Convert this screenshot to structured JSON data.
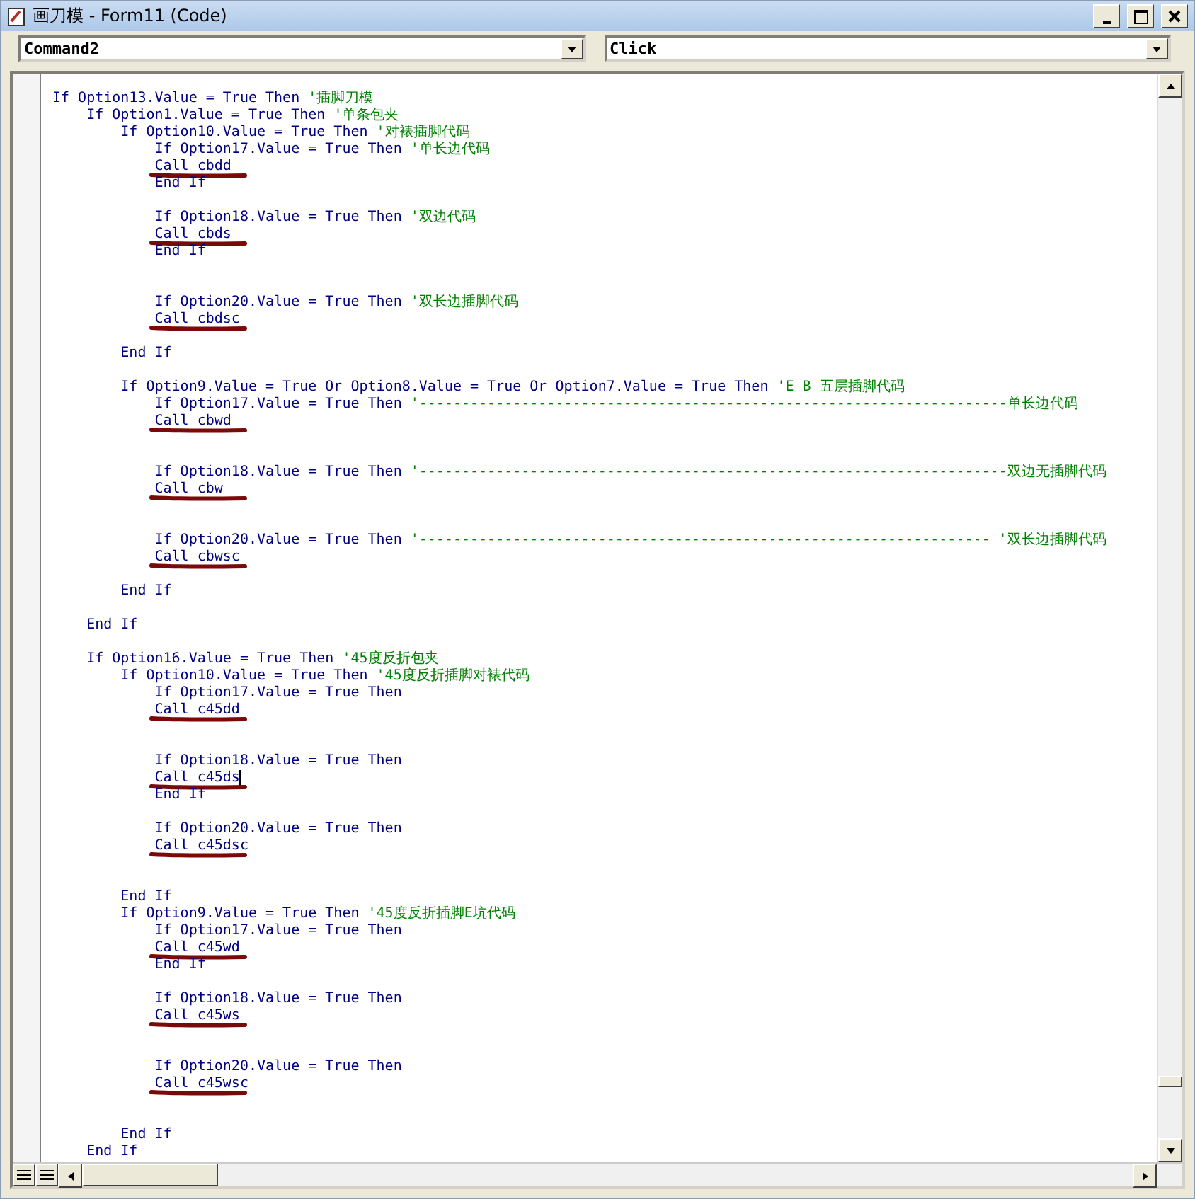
{
  "window": {
    "title": "画刀模 - Form11 (Code)"
  },
  "object_combo": {
    "value": "Command2"
  },
  "procedure_combo": {
    "value": "Click"
  },
  "code_lines": [
    {
      "kind": "code",
      "code": "If Option13.Value = True Then ",
      "comment": "'插脚刀模"
    },
    {
      "kind": "code",
      "code": "    If Option1.Value = True Then ",
      "comment": "'单条包夹"
    },
    {
      "kind": "code",
      "code": "        If Option10.Value = True Then ",
      "comment": "'对裱插脚代码"
    },
    {
      "kind": "code",
      "code": "            If Option17.Value = True Then ",
      "comment": "'单长边代码"
    },
    {
      "kind": "code",
      "code": "            Call cbdd",
      "redacted": true
    },
    {
      "kind": "code",
      "code": "            End If"
    },
    {
      "kind": "blank"
    },
    {
      "kind": "code",
      "code": "            If Option18.Value = True Then ",
      "comment": "'双边代码"
    },
    {
      "kind": "code",
      "code": "            Call cbds",
      "redacted": true
    },
    {
      "kind": "code",
      "code": "            End If"
    },
    {
      "kind": "blank"
    },
    {
      "kind": "blank"
    },
    {
      "kind": "code",
      "code": "            If Option20.Value = True Then ",
      "comment": "'双长边插脚代码"
    },
    {
      "kind": "code",
      "code": "            Call cbdsc",
      "redacted": true
    },
    {
      "kind": "blank"
    },
    {
      "kind": "code",
      "code": "        End If"
    },
    {
      "kind": "blank"
    },
    {
      "kind": "code",
      "code": "        If Option9.Value = True Or Option8.Value = True Or Option7.Value = True Then ",
      "comment": "'E B 五层插脚代码"
    },
    {
      "kind": "code",
      "code": "            If Option17.Value = True Then ",
      "comment": "'---------------------------------------------------------------------单长边代码"
    },
    {
      "kind": "code",
      "code": "            Call cbwd",
      "redacted": true
    },
    {
      "kind": "blank"
    },
    {
      "kind": "blank"
    },
    {
      "kind": "code",
      "code": "            If Option18.Value = True Then ",
      "comment": "'---------------------------------------------------------------------双边无插脚代码"
    },
    {
      "kind": "code",
      "code": "            Call cbw",
      "redacted": true
    },
    {
      "kind": "blank"
    },
    {
      "kind": "blank"
    },
    {
      "kind": "code",
      "code": "            If Option20.Value = True Then ",
      "comment": "'------------------------------------------------------------------- '双长边插脚代码"
    },
    {
      "kind": "code",
      "code": "            Call cbwsc",
      "redacted": true
    },
    {
      "kind": "blank"
    },
    {
      "kind": "code",
      "code": "        End If"
    },
    {
      "kind": "blank"
    },
    {
      "kind": "code",
      "code": "    End If"
    },
    {
      "kind": "blank"
    },
    {
      "kind": "code",
      "code": "    If Option16.Value = True Then ",
      "comment": "'45度反折包夹"
    },
    {
      "kind": "code",
      "code": "        If Option10.Value = True Then ",
      "comment": "'45度反折插脚对裱代码"
    },
    {
      "kind": "code",
      "code": "            If Option17.Value = True Then"
    },
    {
      "kind": "code",
      "code": "            Call c45dd",
      "redacted": true
    },
    {
      "kind": "blank"
    },
    {
      "kind": "blank"
    },
    {
      "kind": "code",
      "code": "            If Option18.Value = True Then"
    },
    {
      "kind": "code",
      "code": "            Call c45ds",
      "redacted": true,
      "caret": true
    },
    {
      "kind": "code",
      "code": "            End If"
    },
    {
      "kind": "blank"
    },
    {
      "kind": "code",
      "code": "            If Option20.Value = True Then"
    },
    {
      "kind": "code",
      "code": "            Call c45dsc",
      "redacted": true
    },
    {
      "kind": "blank"
    },
    {
      "kind": "blank"
    },
    {
      "kind": "code",
      "code": "        End If"
    },
    {
      "kind": "code",
      "code": "        If Option9.Value = True Then ",
      "comment": "'45度反折插脚E坑代码"
    },
    {
      "kind": "code",
      "code": "            If Option17.Value = True Then"
    },
    {
      "kind": "code",
      "code": "            Call c45wd",
      "redacted": true
    },
    {
      "kind": "code",
      "code": "            End If"
    },
    {
      "kind": "blank"
    },
    {
      "kind": "code",
      "code": "            If Option18.Value = True Then"
    },
    {
      "kind": "code",
      "code": "            Call c45ws",
      "redacted": true
    },
    {
      "kind": "blank"
    },
    {
      "kind": "blank"
    },
    {
      "kind": "code",
      "code": "            If Option20.Value = True Then"
    },
    {
      "kind": "code",
      "code": "            Call c45wsc",
      "redacted": true
    },
    {
      "kind": "blank"
    },
    {
      "kind": "blank"
    },
    {
      "kind": "code",
      "code": "        End If"
    },
    {
      "kind": "code",
      "code": "    End If"
    }
  ]
}
